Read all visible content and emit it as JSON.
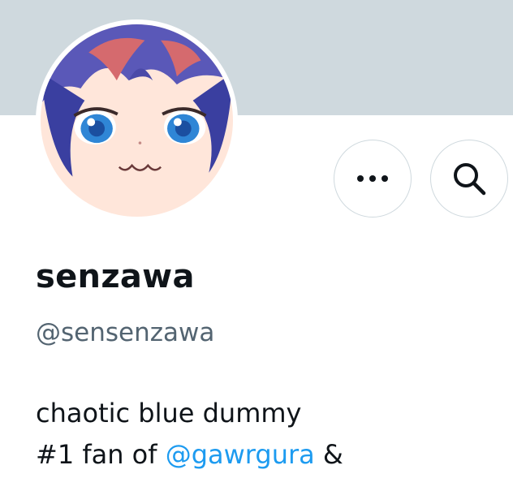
{
  "profile": {
    "display_name": "senzawa",
    "handle": "@sensenzawa",
    "bio": {
      "line1": "chaotic blue dummy",
      "line2_prefix": "#1 fan of ",
      "line2_mention": "@gawrgura",
      "line2_suffix": " &"
    }
  },
  "actions": {
    "more_icon": "more-horizontal-icon",
    "search_icon": "search-icon"
  },
  "colors": {
    "banner": "#cfd9de",
    "mention": "#1d9bf0",
    "handle": "#536471",
    "text": "#0f1419"
  }
}
